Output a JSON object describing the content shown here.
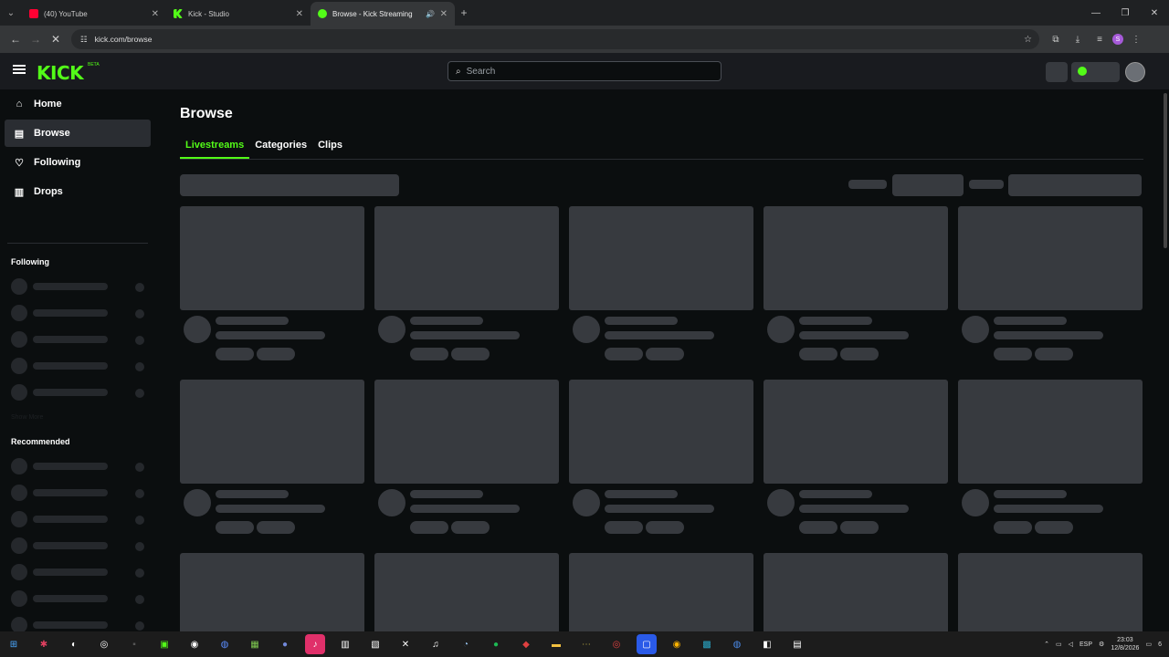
{
  "browser": {
    "tabs": [
      {
        "title": "(40) YouTube",
        "icon": "youtube-icon",
        "active": false
      },
      {
        "title": "Kick - Studio",
        "icon": "kick-icon",
        "active": false
      },
      {
        "title": "Browse - Kick Streaming",
        "icon": "kick-loading-icon",
        "active": true
      }
    ],
    "url": "kick.com/browse",
    "profile_initial": "S"
  },
  "header": {
    "logo": "KICK",
    "beta": "BETA",
    "search_placeholder": "Search"
  },
  "sidebar": {
    "nav": [
      {
        "label": "Home",
        "icon": "home-icon"
      },
      {
        "label": "Browse",
        "icon": "browse-icon"
      },
      {
        "label": "Following",
        "icon": "heart-icon"
      },
      {
        "label": "Drops",
        "icon": "drops-icon"
      }
    ],
    "following_heading": "Following",
    "show_more": "Show More",
    "recommended_heading": "Recommended"
  },
  "main": {
    "title": "Browse",
    "tabs": [
      "Livestreams",
      "Categories",
      "Clips"
    ],
    "active_tab": "Livestreams"
  },
  "taskbar": {
    "language": "ESP",
    "time": "23:03",
    "date": "12/8/2026",
    "notification_count": "6"
  },
  "colors": {
    "accent": "#53fc18",
    "skeleton": "#373a3f",
    "background": "#0b0e0f"
  }
}
